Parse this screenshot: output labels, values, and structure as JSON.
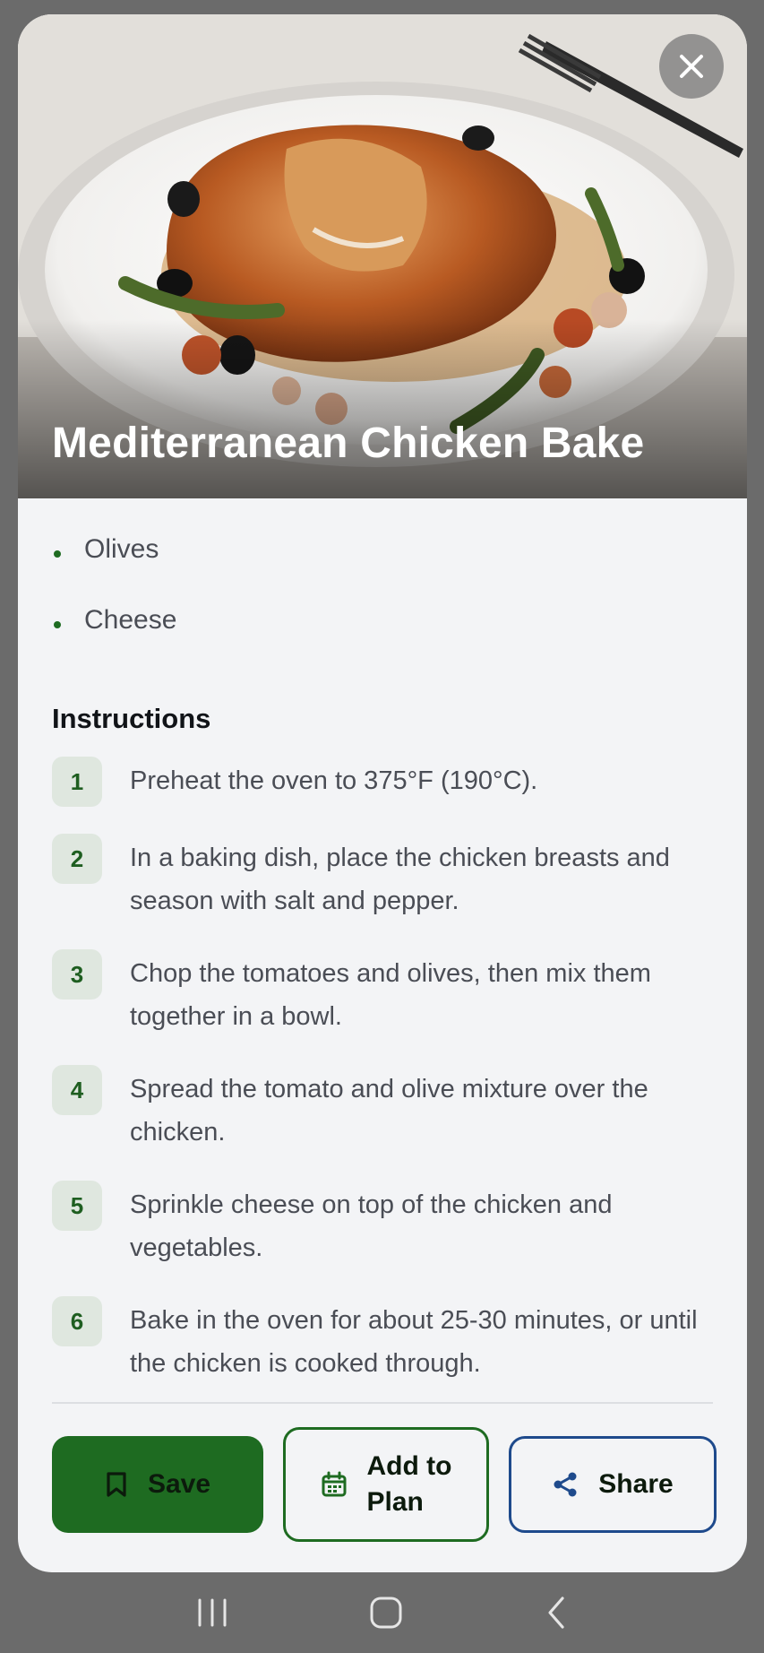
{
  "hero": {
    "title": "Mediterranean Chicken Bake",
    "close_icon": "close-icon"
  },
  "ingredients": [
    {
      "label": "Olives"
    },
    {
      "label": "Cheese"
    }
  ],
  "instructions": {
    "title": "Instructions",
    "steps": [
      {
        "num": "1",
        "text": "Preheat the oven to 375°F (190°C)."
      },
      {
        "num": "2",
        "text": "In a baking dish, place the chicken breasts and season with salt and pepper."
      },
      {
        "num": "3",
        "text": "Chop the tomatoes and olives, then mix them together in a bowl."
      },
      {
        "num": "4",
        "text": "Spread the tomato and olive mixture over the chicken."
      },
      {
        "num": "5",
        "text": "Sprinkle cheese on top of the chicken and vegetables."
      },
      {
        "num": "6",
        "text": "Bake in the oven for about 25-30 minutes, or until the chicken is cooked through."
      }
    ]
  },
  "actions": {
    "save_label": "Save",
    "plan_label_line1": "Add to",
    "plan_label_line2": "Plan",
    "share_label": "Share"
  },
  "colors": {
    "primary_green": "#1e6b21",
    "share_blue": "#1e4a8c",
    "card_bg": "#f3f4f6"
  },
  "system_nav": {
    "recents_icon": "recents-icon",
    "home_icon": "home-icon",
    "back_icon": "back-icon"
  }
}
